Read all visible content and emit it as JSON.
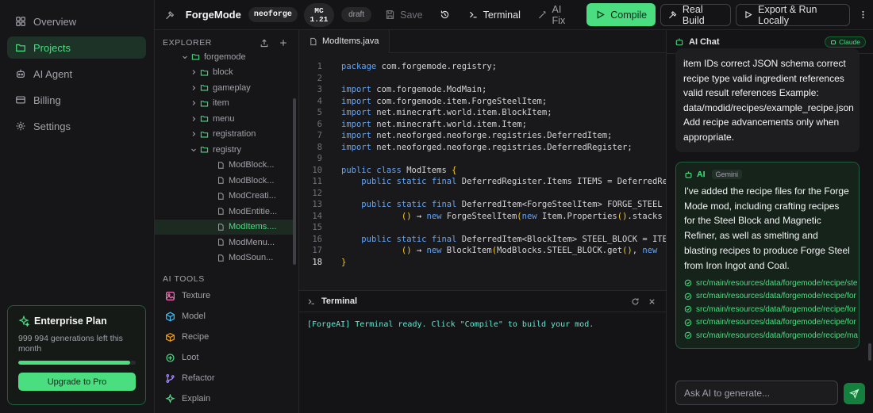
{
  "nav": {
    "items": [
      {
        "label": "Overview",
        "icon": "grid-icon"
      },
      {
        "label": "Projects",
        "icon": "folder-icon",
        "active": true
      },
      {
        "label": "AI Agent",
        "icon": "bot-icon"
      },
      {
        "label": "Billing",
        "icon": "card-icon"
      },
      {
        "label": "Settings",
        "icon": "gear-icon"
      }
    ]
  },
  "plan": {
    "title": "Enterprise Plan",
    "subtitle": "999 994 generations left this month",
    "progress": 0.95,
    "button": "Upgrade to Pro"
  },
  "topbar": {
    "project_name": "ForgeMode",
    "loader": "neoforge",
    "mc_label": "MC",
    "mc_version": "1.21",
    "status": "draft",
    "save": "Save",
    "terminal": "Terminal",
    "ai_fix": "AI Fix",
    "compile": "Compile",
    "real_build": "Real Build",
    "export": "Export & Run Locally"
  },
  "explorer": {
    "title": "EXPLORER",
    "tree": [
      {
        "label": "forgemode",
        "type": "folder",
        "open": true,
        "depth": 0
      },
      {
        "label": "block",
        "type": "folder",
        "open": false,
        "depth": 1
      },
      {
        "label": "gameplay",
        "type": "folder",
        "open": false,
        "depth": 1
      },
      {
        "label": "item",
        "type": "folder",
        "open": false,
        "depth": 1
      },
      {
        "label": "menu",
        "type": "folder",
        "open": false,
        "depth": 1
      },
      {
        "label": "registration",
        "type": "folder",
        "open": false,
        "depth": 1
      },
      {
        "label": "registry",
        "type": "folder",
        "open": true,
        "depth": 1
      },
      {
        "label": "ModBlock...",
        "type": "file",
        "depth": 2
      },
      {
        "label": "ModBlock...",
        "type": "file",
        "depth": 2
      },
      {
        "label": "ModCreati...",
        "type": "file",
        "depth": 2
      },
      {
        "label": "ModEntitie...",
        "type": "file",
        "depth": 2
      },
      {
        "label": "ModItems....",
        "type": "file",
        "depth": 2,
        "selected": true
      },
      {
        "label": "ModMenu...",
        "type": "file",
        "depth": 2
      },
      {
        "label": "ModSoun...",
        "type": "file",
        "depth": 2
      }
    ]
  },
  "ai_tools": {
    "title": "AI TOOLS",
    "items": [
      {
        "label": "Texture",
        "icon": "image-icon",
        "color": "#f472b6"
      },
      {
        "label": "Model",
        "icon": "cube-icon",
        "color": "#38bdf8"
      },
      {
        "label": "Recipe",
        "icon": "box-icon",
        "color": "#f59e0b"
      },
      {
        "label": "Loot",
        "icon": "loot-icon",
        "color": "#4ade80"
      },
      {
        "label": "Refactor",
        "icon": "branch-icon",
        "color": "#a78bfa"
      },
      {
        "label": "Explain",
        "icon": "sparkle-icon",
        "color": "#4ade80"
      }
    ]
  },
  "editor": {
    "tab": "ModItems.java",
    "current_line": 18,
    "lines": [
      "package com.forgemode.registry;",
      "",
      "import com.forgemode.ModMain;",
      "import com.forgemode.item.ForgeSteelItem;",
      "import net.minecraft.world.item.BlockItem;",
      "import net.minecraft.world.item.Item;",
      "import net.neoforged.neoforge.registries.DeferredItem;",
      "import net.neoforged.neoforge.registries.DeferredRegister;",
      "",
      "public class ModItems {",
      "    public static final DeferredRegister.Items ITEMS = DeferredRe",
      "",
      "    public static final DeferredItem<ForgeSteelItem> FORGE_STEEL",
      "            () -> new ForgeSteelItem(new Item.Properties().stacks",
      "",
      "    public static final DeferredItem<BlockItem> STEEL_BLOCK = ITE",
      "            () -> new BlockItem(ModBlocks.STEEL_BLOCK.get(), new",
      "}"
    ]
  },
  "terminal": {
    "title": "Terminal",
    "output": "[ForgeAI] Terminal ready. Click \"Compile\" to build your mod."
  },
  "chat": {
    "title": "AI Chat",
    "model_badge": "Claude",
    "user_message_lines": [
      "item IDs correct JSON schema correct",
      "recipe type valid ingredient references",
      "valid result references  Example:",
      "data/modid/recipes/example_recipe.json",
      "Add recipe advancements only when",
      "appropriate."
    ],
    "ai_label": "AI",
    "ai_model": "Gemini",
    "ai_message": "I've added the recipe files for the Forge Mode mod, including crafting recipes for the Steel Block and Magnetic Refiner, as well as smelting and blasting recipes to produce Forge Steel from Iron Ingot and Coal.",
    "files": [
      "src/main/resources/data/forgemode/recipe/ste",
      "src/main/resources/data/forgemode/recipe/for",
      "src/main/resources/data/forgemode/recipe/for",
      "src/main/resources/data/forgemode/recipe/for",
      "src/main/resources/data/forgemode/recipe/ma"
    ],
    "input_placeholder": "Ask AI to generate..."
  }
}
